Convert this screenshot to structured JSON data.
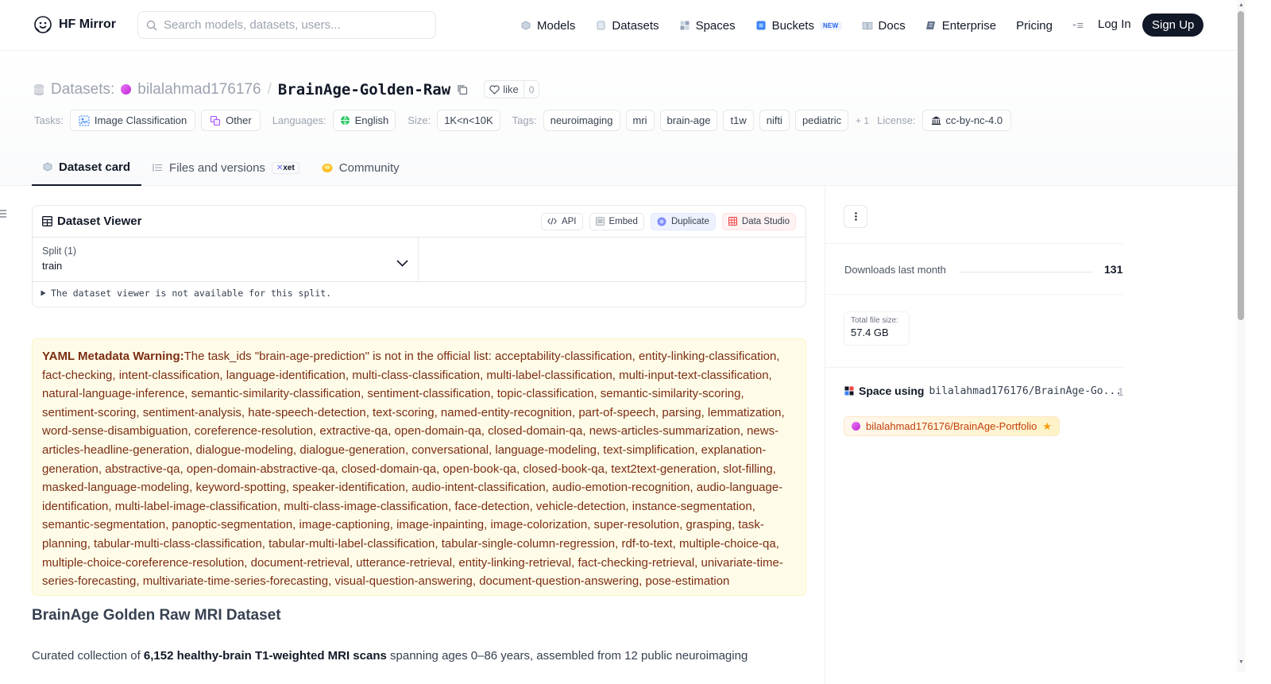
{
  "nav": {
    "brand": "HF Mirror",
    "search_placeholder": "Search models, datasets, users...",
    "items": [
      {
        "label": "Models",
        "icon": "models-icon"
      },
      {
        "label": "Datasets",
        "icon": "datasets-icon"
      },
      {
        "label": "Spaces",
        "icon": "spaces-icon"
      },
      {
        "label": "Buckets",
        "icon": "buckets-icon",
        "badge": "NEW"
      },
      {
        "label": "Docs",
        "icon": "docs-icon"
      },
      {
        "label": "Enterprise",
        "icon": "enterprise-icon"
      },
      {
        "label": "Pricing"
      }
    ],
    "login": "Log In",
    "signup": "Sign Up"
  },
  "repo": {
    "prefix": "Datasets:",
    "owner": "bilalahmad176176",
    "separator": "/",
    "name": "BrainAge-Golden-Raw",
    "like_label": "like",
    "like_count": "0"
  },
  "tags": {
    "tasks_label": "Tasks:",
    "tasks": [
      "Image Classification",
      "Other"
    ],
    "languages_label": "Languages:",
    "languages": [
      "English"
    ],
    "size_label": "Size:",
    "size": "1K<n<10K",
    "tags_label": "Tags:",
    "tags": [
      "neuroimaging",
      "mri",
      "brain-age",
      "t1w",
      "nifti",
      "pediatric"
    ],
    "more": "+ 1",
    "license_label": "License:",
    "license": "cc-by-nc-4.0"
  },
  "tabs": [
    {
      "label": "Dataset card",
      "active": true
    },
    {
      "label": "Files and versions",
      "badge": "xet"
    },
    {
      "label": "Community"
    }
  ],
  "viewer": {
    "title": "Dataset Viewer",
    "actions": [
      "API",
      "Embed",
      "Duplicate",
      "Data Studio"
    ],
    "split_label": "Split (1)",
    "split_value": "train",
    "note": "The dataset viewer is not available for this split."
  },
  "warning": {
    "title": "YAML Metadata Warning:",
    "text": "The task_ids \"brain-age-prediction\" is not in the official list: acceptability-classification, entity-linking-classification, fact-checking, intent-classification, language-identification, multi-class-classification, multi-label-classification, multi-input-text-classification, natural-language-inference, semantic-similarity-classification, sentiment-classification, topic-classification, semantic-similarity-scoring, sentiment-scoring, sentiment-analysis, hate-speech-detection, text-scoring, named-entity-recognition, part-of-speech, parsing, lemmatization, word-sense-disambiguation, coreference-resolution, extractive-qa, open-domain-qa, closed-domain-qa, news-articles-summarization, news-articles-headline-generation, dialogue-modeling, dialogue-generation, conversational, language-modeling, text-simplification, explanation-generation, abstractive-qa, open-domain-abstractive-qa, closed-domain-qa, open-book-qa, closed-book-qa, text2text-generation, slot-filling, masked-language-modeling, keyword-spotting, speaker-identification, audio-intent-classification, audio-emotion-recognition, audio-language-identification, multi-label-image-classification, multi-class-image-classification, face-detection, vehicle-detection, instance-segmentation, semantic-segmentation, panoptic-segmentation, image-captioning, image-inpainting, image-colorization, super-resolution, grasping, task-planning, tabular-multi-class-classification, tabular-multi-label-classification, tabular-single-column-regression, rdf-to-text, multiple-choice-qa, multiple-choice-coreference-resolution, document-retrieval, utterance-retrieval, entity-linking-retrieval, fact-checking-retrieval, univariate-time-series-forecasting, multivariate-time-series-forecasting, visual-question-answering, document-question-answering, pose-estimation"
  },
  "card": {
    "heading": "BrainAge Golden Raw MRI Dataset",
    "intro_pre": "Curated collection of ",
    "intro_bold": "6,152 healthy-brain T1-weighted MRI scans",
    "intro_post": " spanning ages 0–86 years, assembled from 12 public neuroimaging"
  },
  "sidebar": {
    "downloads_label": "Downloads last month",
    "downloads_value": "131",
    "filesize_label": "Total file size:",
    "filesize_value": "57.4 GB",
    "space_using_label": "Space using",
    "space_using_repo": "bilalahmad176176/BrainAge-Go...",
    "space_count": "1",
    "space_chip": "bilalahmad176176/BrainAge-Portfolio"
  },
  "colors": {
    "warning_bg": "#fefce8",
    "warning_text": "#7c2d12",
    "signup_bg": "#111827",
    "space_chip_text": "#c2410c"
  }
}
